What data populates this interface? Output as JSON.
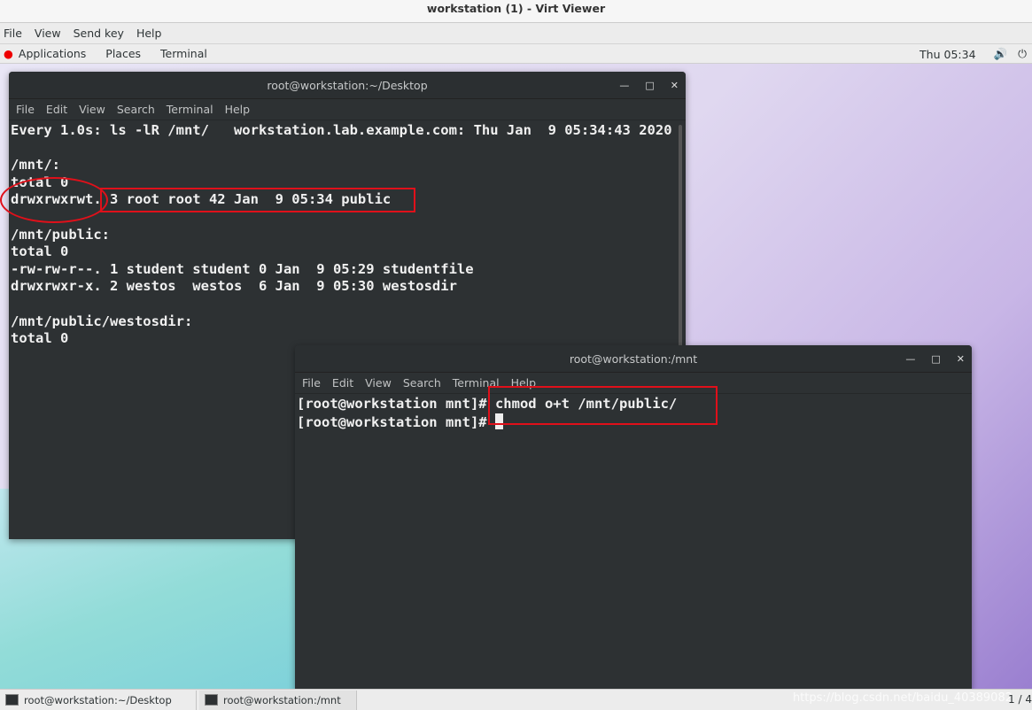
{
  "window": {
    "title": "workstation (1) - Virt Viewer"
  },
  "viewer_menu": [
    "File",
    "View",
    "Send key",
    "Help"
  ],
  "top_bar": {
    "items": [
      "Applications",
      "Places",
      "Terminal"
    ],
    "clock": "Thu 05:34"
  },
  "terminal1": {
    "title": "root@workstation:~/Desktop",
    "menu": [
      "File",
      "Edit",
      "View",
      "Search",
      "Terminal",
      "Help"
    ],
    "lines": [
      "Every 1.0s: ls -lR /mnt/   workstation.lab.example.com: Thu Jan  9 05:34:43 2020",
      "",
      "/mnt/:",
      "total 0",
      "drwxrwxrwt. 3 root root 42 Jan  9 05:34 public",
      "",
      "/mnt/public:",
      "total 0",
      "-rw-rw-r--. 1 student student 0 Jan  9 05:29 studentfile",
      "drwxrwxr-x. 2 westos  westos  6 Jan  9 05:30 westosdir",
      "",
      "/mnt/public/westosdir:",
      "total 0"
    ]
  },
  "terminal2": {
    "title": "root@workstation:/mnt",
    "menu": [
      "File",
      "Edit",
      "View",
      "Search",
      "Terminal",
      "Help"
    ],
    "lines": [
      "[root@workstation mnt]# chmod o+t /mnt/public/",
      "[root@workstation mnt]# "
    ]
  },
  "taskbar": {
    "items": [
      "root@workstation:~/Desktop",
      "root@workstation:/mnt"
    ],
    "pager": "1 / 4"
  },
  "watermark": "https://blog.csdn.net/baidu_40389082",
  "colors": {
    "highlight": "#e0101a",
    "terminal_bg": "#2d3133"
  }
}
